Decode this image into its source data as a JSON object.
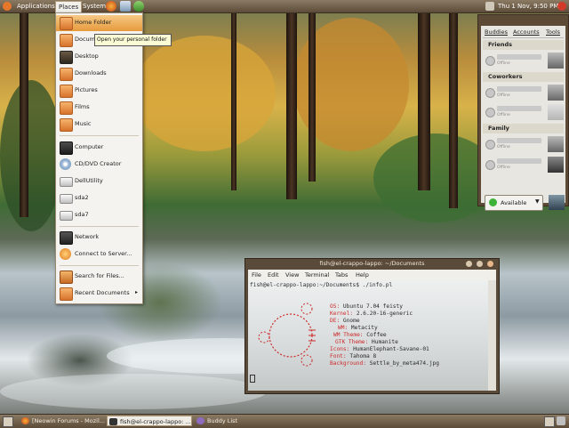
{
  "top_panel": {
    "menus": [
      "Applications",
      "Places",
      "System"
    ],
    "clock": "Thu 1 Nov, 9:50 PM"
  },
  "places_menu": {
    "items": [
      {
        "label": "Home Folder",
        "icon": "home-folder-icon"
      },
      {
        "label": "Documents",
        "icon": "folder-icon"
      },
      {
        "label": "Desktop",
        "icon": "desktop-icon"
      },
      {
        "label": "Downloads",
        "icon": "folder-icon"
      },
      {
        "label": "Pictures",
        "icon": "folder-icon"
      },
      {
        "label": "Films",
        "icon": "folder-icon"
      },
      {
        "label": "Music",
        "icon": "folder-icon"
      },
      {
        "label": "Computer",
        "icon": "computer-icon"
      },
      {
        "label": "CD/DVD Creator",
        "icon": "cd-icon"
      },
      {
        "label": "DellUtility",
        "icon": "drive-icon"
      },
      {
        "label": "sda2",
        "icon": "drive-icon"
      },
      {
        "label": "sda7",
        "icon": "drive-icon"
      },
      {
        "label": "Network",
        "icon": "network-icon"
      },
      {
        "label": "Connect to Server...",
        "icon": "connect-icon"
      },
      {
        "label": "Search for Files...",
        "icon": "search-icon"
      },
      {
        "label": "Recent Documents",
        "icon": "recent-icon"
      }
    ],
    "tooltip": "Open your personal folder"
  },
  "buddy_list": {
    "menu": [
      "Buddies",
      "Accounts",
      "Tools"
    ],
    "groups": [
      {
        "name": "Friends",
        "buddies": [
          {
            "status": "Offline"
          }
        ]
      },
      {
        "name": "Coworkers",
        "buddies": [
          {
            "status": "Offline"
          },
          {
            "status": "Offline"
          }
        ]
      },
      {
        "name": "Family",
        "buddies": [
          {
            "status": "Offline"
          },
          {
            "status": "Offline"
          }
        ]
      }
    ],
    "status": "Available"
  },
  "terminal": {
    "title": "fish@el-crappo-lappo: ~/Documents",
    "menu": [
      "File",
      "Edit",
      "View",
      "Terminal",
      "Tabs",
      "Help"
    ],
    "prompt": "fish@el-crappo-lappo:~/Documents$ ./info.pl",
    "info": [
      {
        "key": "OS:",
        "value": "Ubuntu 7.04 feisty"
      },
      {
        "key": "Kernel:",
        "value": "2.6.20-16-generic"
      },
      {
        "key": "DE:",
        "value": "Gnome"
      },
      {
        "key": "WM:",
        "value": "Metacity"
      },
      {
        "key": "WM Theme:",
        "value": "Coffee"
      },
      {
        "key": "GTK Theme:",
        "value": "Humanite"
      },
      {
        "key": "Icons:",
        "value": "HumanElephant-Savane-01"
      },
      {
        "key": "Font:",
        "value": "Tahoma 8"
      },
      {
        "key": "Background:",
        "value": "Settle_by_meta474.jpg"
      }
    ]
  },
  "taskbar": {
    "tasks": [
      {
        "label": "[Neowin Forums - Mozil...",
        "active": false
      },
      {
        "label": "fish@el-crappo-lappo: ...",
        "active": true
      },
      {
        "label": "Buddy List",
        "active": false
      }
    ]
  }
}
